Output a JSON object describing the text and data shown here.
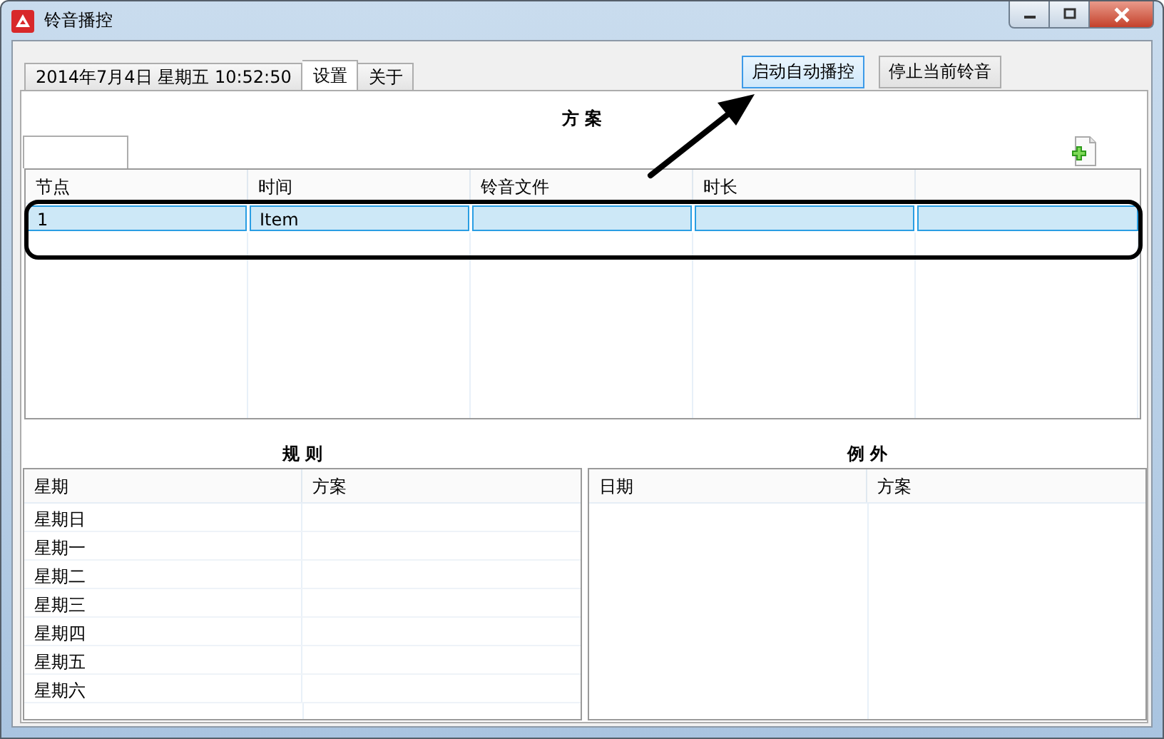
{
  "window": {
    "title": "铃音播控"
  },
  "tabs": [
    {
      "label": "2014年7月4日  星期五   10:52:50",
      "selected": false
    },
    {
      "label": "设置",
      "selected": true
    },
    {
      "label": "关于",
      "selected": false
    }
  ],
  "buttons": [
    {
      "label": "启动自动播控",
      "highlighted": true
    },
    {
      "label": "停止当前铃音",
      "highlighted": false
    }
  ],
  "plan": {
    "title": "方 案",
    "columns": [
      "节点",
      "时间",
      "铃音文件",
      "时长"
    ],
    "rows": [
      {
        "node": "1",
        "time": "Item",
        "selected": true
      }
    ]
  },
  "rules": {
    "title": "规 则",
    "columns": [
      "星期",
      "方案"
    ],
    "rows": [
      {
        "weekday": "星期日"
      },
      {
        "weekday": "星期一"
      },
      {
        "weekday": "星期二"
      },
      {
        "weekday": "星期三"
      },
      {
        "weekday": "星期四"
      },
      {
        "weekday": "星期五"
      },
      {
        "weekday": "星期六"
      }
    ]
  },
  "exceptions": {
    "title": "例 外",
    "columns": [
      "日期",
      "方案"
    ]
  }
}
